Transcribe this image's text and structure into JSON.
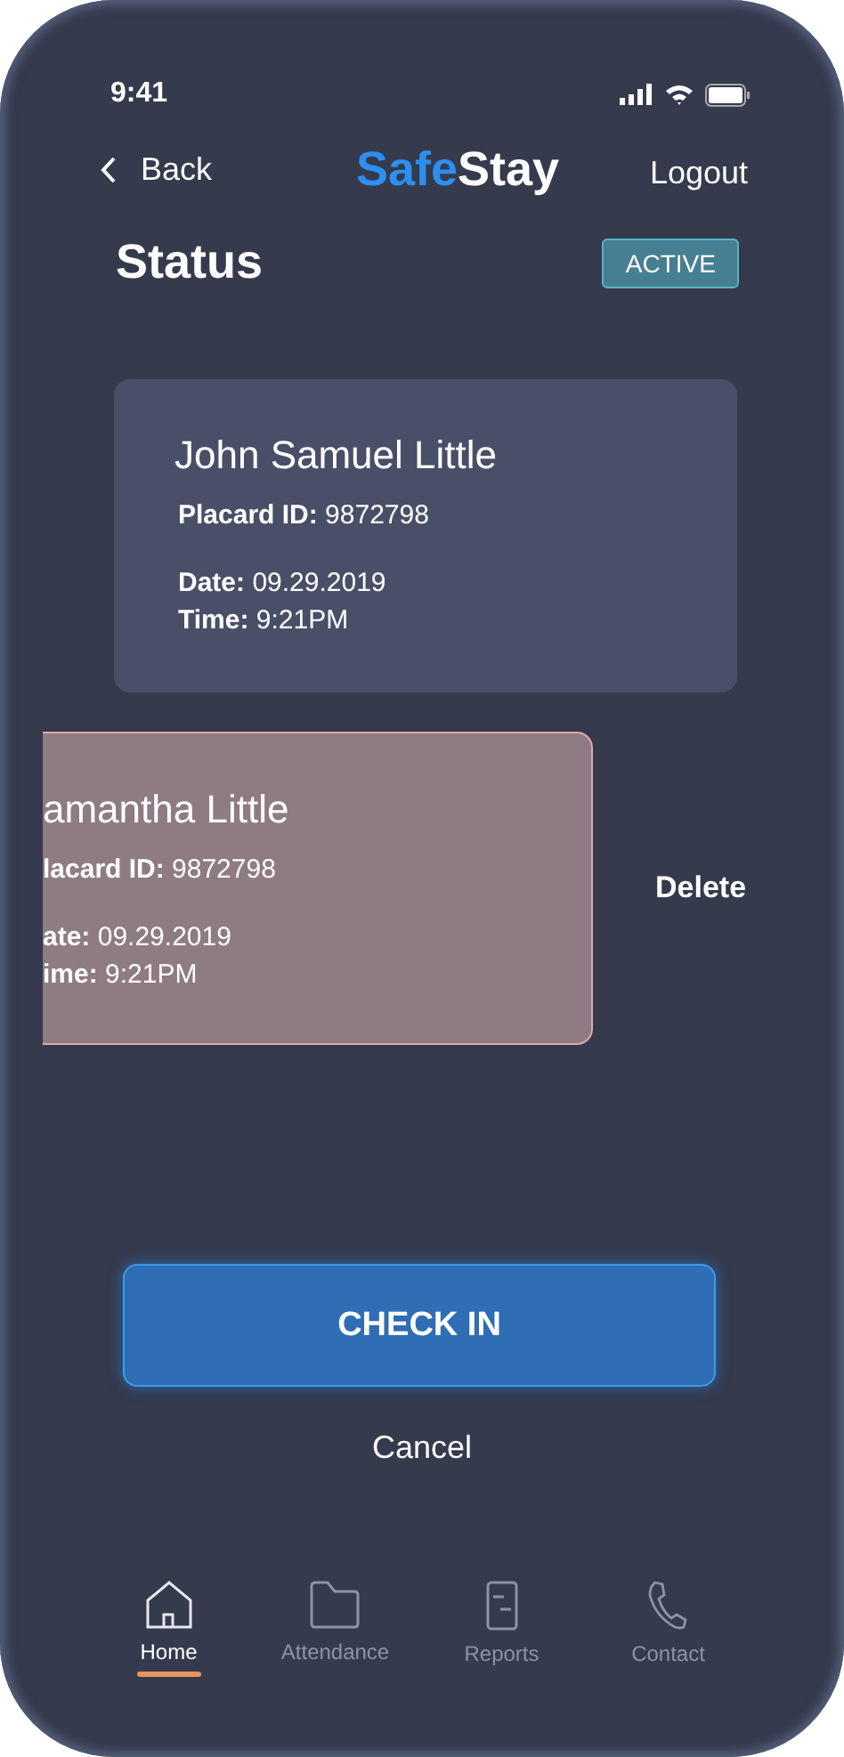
{
  "status_bar": {
    "time": "9:41"
  },
  "header": {
    "back": "Back",
    "brand_part_1": "Safe",
    "brand_part_2": "Stay",
    "logout": "Logout"
  },
  "status": {
    "title": "Status",
    "badge": "ACTIVE"
  },
  "records": [
    {
      "name": "John Samuel Little",
      "swiped": false,
      "fields": [
        {
          "label": "Placard ID:",
          "value": "9872798"
        },
        {
          "label": "Date:",
          "value": "09.29.2019"
        },
        {
          "label": "Time:",
          "value": "9:21PM"
        }
      ]
    },
    {
      "name": "amantha Little",
      "swiped": true,
      "action": "Delete",
      "fields": [
        {
          "label": "lacard ID:",
          "value": "9872798"
        },
        {
          "label": "ate:",
          "value": "09.29.2019"
        },
        {
          "label": "ime:",
          "value": "9:21PM"
        }
      ]
    }
  ],
  "primary_button": "CHECK IN",
  "secondary_button": "Cancel",
  "nav": [
    {
      "label": "Home",
      "kind": "home",
      "selected": true
    },
    {
      "label": "Attendance",
      "kind": "folder",
      "selected": false
    },
    {
      "label": "Reports",
      "kind": "reports",
      "selected": false
    },
    {
      "label": "Contact",
      "kind": "phone",
      "selected": false
    }
  ]
}
